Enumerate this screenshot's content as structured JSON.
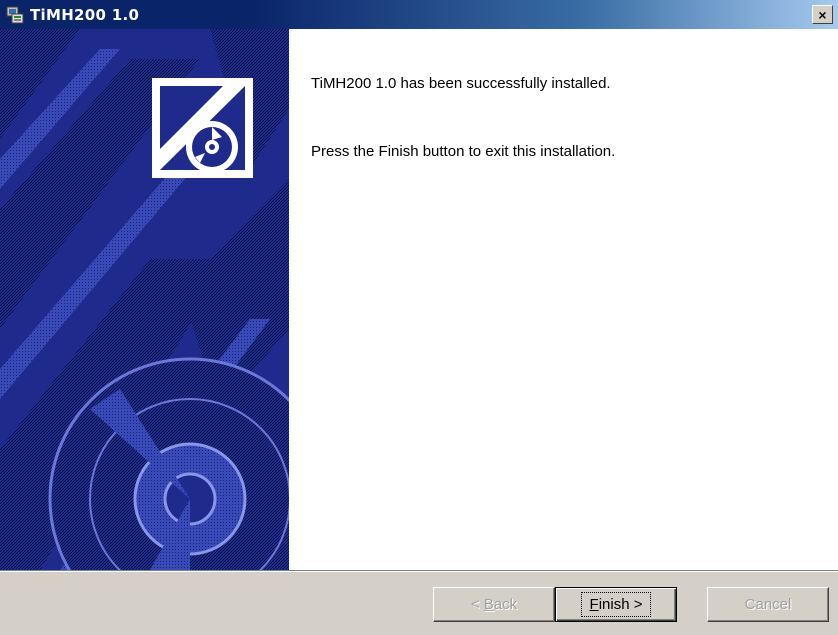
{
  "window": {
    "title": "TiMH200 1.0",
    "close_label": "×"
  },
  "content": {
    "message_installed": "TiMH200 1.0 has been successfully installed.",
    "message_finish": "Press the Finish button to exit this installation."
  },
  "buttons": {
    "back_prefix": "< ",
    "back_accel": "B",
    "back_rest": "ack",
    "finish_accel": "F",
    "finish_rest": "inish >",
    "cancel_label": "Cancel"
  },
  "colors": {
    "titlebar_start": "#0a246a",
    "titlebar_end": "#a6caf0",
    "banner_blue": "#1e2a8c",
    "face": "#d4d0c8"
  },
  "icons": {
    "title_icon": "installer-icon",
    "banner_logo": "install-disc-logo-icon"
  }
}
